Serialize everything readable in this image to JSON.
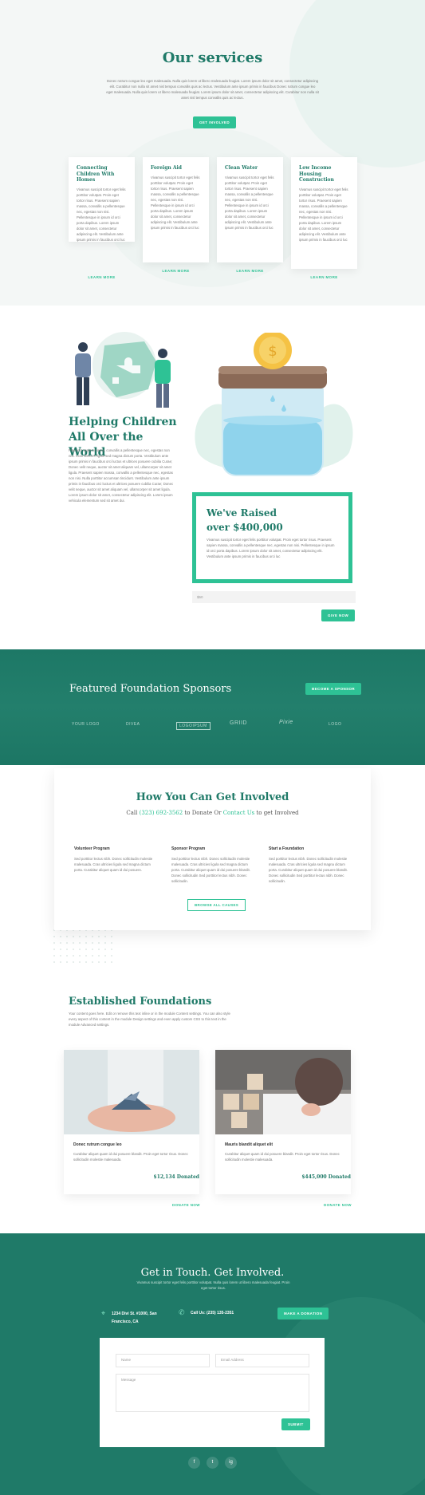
{
  "services": {
    "title": "Our services",
    "intro": "Donec rutrum congue leo eget malesuada. Nulla quis lorem ut libero malesuada feugiat. Lorem ipsum dolor sit amet, consectetur adipiscing elit. Curabitur non nulla sit amet nisl tempus convallis quis ac lectus. Vestibulum ante ipsum primis in faucibus Donec rutrum congue leo eget malesuada. Nulla quis lorem ut libero malesuada feugiat. Lorem ipsum dolor sit amet, consectetur adipiscing elit. Curabitur non nulla sit amet nisl tempus convallis quis ac lectus.",
    "button": "Get Involved",
    "cards": [
      {
        "title": "Connecting Children With Homes",
        "text": "Vivamus suscipit tortor eget felis porttitor volutpat. Proin eget tortor risus. Praesent sapien massa, convallis a pellentesque nec, egestas non nisi. Pellentesque in ipsum id orci porta dapibus. Lorem ipsum dolor sit amet, consectetur adipiscing elit. Vestibulum ante ipsum primis in faucibus orci luc",
        "link": "Learn More"
      },
      {
        "title": "Foreign Aid",
        "text": "Vivamus suscipit tortor eget felis porttitor volutpat. Proin eget tortor risus. Praesent sapien massa, convallis a pellentesque nec, egestas non nisi. Pellentesque in ipsum id orci porta dapibus. Lorem ipsum dolor sit amet, consectetur adipiscing elit. Vestibulum ante ipsum primis in faucibus orci luc",
        "link": "Learn More"
      },
      {
        "title": "Clean Water",
        "text": "Vivamus suscipit tortor eget felis porttitor volutpat. Proin eget tortor risus. Praesent sapien massa, convallis a pellentesque nec, egestas non nisi. Pellentesque in ipsum id orci porta dapibus. Lorem ipsum dolor sit amet, consectetur adipiscing elit. Vestibulum ante ipsum primis in faucibus orci luc",
        "link": "Learn More"
      },
      {
        "title": "Low Income Housing Construction",
        "text": "Vivamus suscipit tortor eget felis porttitor volutpat. Proin eget tortor risus. Praesent sapien massa, convallis a pellentesque nec, egestas non nisi. Pellentesque in ipsum id orci porta dapibus. Lorem ipsum dolor sit amet, consectetur adipiscing elit. Vestibulum ante ipsum primis in faucibus orci luc",
        "link": "Learn More"
      }
    ]
  },
  "mission": {
    "title": "Helping Children All Over the World",
    "text": "Praesent sapien massa, convallis a pellentesque nec, egestas non nisi. Cras ultricies ligula sed magna dictum porta. Vestibulum ante ipsum primis in faucibus orci luctus et ultrices posuere cubilia Curae; Donec velit neque, auctor sit amet aliquam vel, ullamcorper sit amet ligula. Praesent sapien massa, convallis a pellentesque nec, egestas non nisi. Nulla porttitor accumsan tincidunt. Vestibulum ante ipsum primis in faucibus orci luctus et ultrices posuere cubilia Curae; Donec velit neque, auctor sit amet aliquam vel, ullamcorper sit amet ligula. Lorem ipsum dolor sit amet, consectetur adipiscing elit. Lorem ipsum vehicula elementum sed sit amet dui.",
    "raised_title": "We've Raised over $400,000",
    "raised_text": "Vivamus suscipit tortor eget felis porttitor volutpat. Proin eget tortor risus. Praesent sapien massa, convallis a pellentesque nec, egestas non nisi. Pellentesque in ipsum id orci porta dapibus. Lorem ipsum dolor sit amet, consectetur adipiscing elit. Vestibulum ante ipsum primis in faucibus orci luc",
    "amount_placeholder": "$50",
    "give_button": "Give Now"
  },
  "sponsors": {
    "title": "Featured Foundation Sponsors",
    "button": "Become a Sponsor",
    "logos": [
      "YOUR LOGO",
      "DIVEA",
      "LOGOIPSUM",
      "GRIID",
      "Pixie",
      "LOGO"
    ]
  },
  "involved": {
    "title": "How You Can Get Involved",
    "sub_call": "Call",
    "phone": "(323) 692-3562",
    "sub_mid": "to Donate Or",
    "contact_link": "Contact Us",
    "sub_end": "to get Involved",
    "columns": [
      {
        "title": "Volunteer Program",
        "text": "Sed porttitor lectus nibh. Donec sollicitudin molestie malesuada. Cras ultricies ligula sed magna dictum porta. Curabitur aliquet quam id dui posuere."
      },
      {
        "title": "Sponsor Program",
        "text": "Sed porttitor lectus nibh. Donec sollicitudin molestie malesuada. Cras ultricies ligula sed magna dictum porta. Curabitur aliquet quam id dui posuere blandit. Donec sollicitudin Sed porttitor lectus nibh. Donec sollicitudin."
      },
      {
        "title": "Start a Foundation",
        "text": "Sed porttitor lectus nibh. Donec sollicitudin molestie malesuada. Cras ultricies ligula sed magna dictum porta. Curabitur aliquet quam id dui posuere blandit. Donec sollicitudin Sed porttitor lectus nibh. Donec sollicitudin."
      }
    ],
    "button": "Browse All Causes"
  },
  "foundations": {
    "title": "Established Foundations",
    "intro": "Your content goes here. Edit or remove this text inline or in the module Content settings. You can also style every aspect of this content in the module Design settings and even apply custom CSS to this text in the module Advanced settings.",
    "items": [
      {
        "title": "Donec rutrum congue leo",
        "text": "Curabitur aliquet quam id dui posuere blandit. Proin eget tortor risus. Donec sollicitudin molestie malesuada.",
        "amount": "$12,134 Donated",
        "link": "Donate Now"
      },
      {
        "title": "Mauris blandit aliquet elit",
        "text": "Curabitur aliquet quam id dui posuere blandit. Proin eget tortor risus. Donec sollicitudin molestie malesuada.",
        "amount": "$445,000 Donated",
        "link": "Donate Now"
      }
    ]
  },
  "contact": {
    "title": "Get in Touch. Get Involved.",
    "intro": "Vivamus suscipit tortor eget felis porttitor volutpat. Nulla quis lorem ut libero malesuada feugiat. Proin eget tortor risus.",
    "address": "1234 Divi St. #1000, San Francisco, CA",
    "phone": "Call Us: (235) 135-2351",
    "donate_button": "Make a Donation",
    "name_placeholder": "Name",
    "email_placeholder": "Email Address",
    "message_placeholder": "Message",
    "submit": "Submit",
    "social": [
      "f",
      "t",
      "ig"
    ]
  },
  "colors": {
    "accent": "#2ec295",
    "dark_teal": "#1f7a68"
  }
}
